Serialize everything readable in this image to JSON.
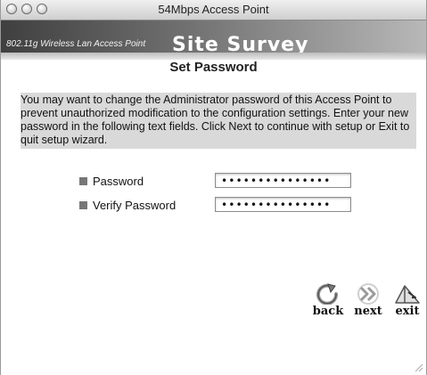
{
  "window": {
    "title": "54Mbps Access Point"
  },
  "banner": {
    "tagline": "802.11g Wireless Lan Access Point",
    "title": "Site Survey"
  },
  "page": {
    "heading": "Set Password",
    "instructions": "You may want to change the Administrator password of this Access Point to prevent unauthorized modification to the configuration settings. Enter your new password in the following text fields. Click Next to continue with setup or Exit to quit setup wizard."
  },
  "form": {
    "password": {
      "label": "Password",
      "value": "•••••••••••••••"
    },
    "verify": {
      "label": "Verify Password",
      "value": "•••••••••••••••"
    }
  },
  "nav": {
    "back_label": "back",
    "next_label": "next",
    "exit_label": "exit"
  },
  "colors": {
    "bullet": "#777777",
    "instructions_bg": "#d9d9d9"
  },
  "icons": [
    "back-arrow-icon",
    "next-arrows-icon",
    "exit-icon",
    "resize-grip-icon"
  ]
}
